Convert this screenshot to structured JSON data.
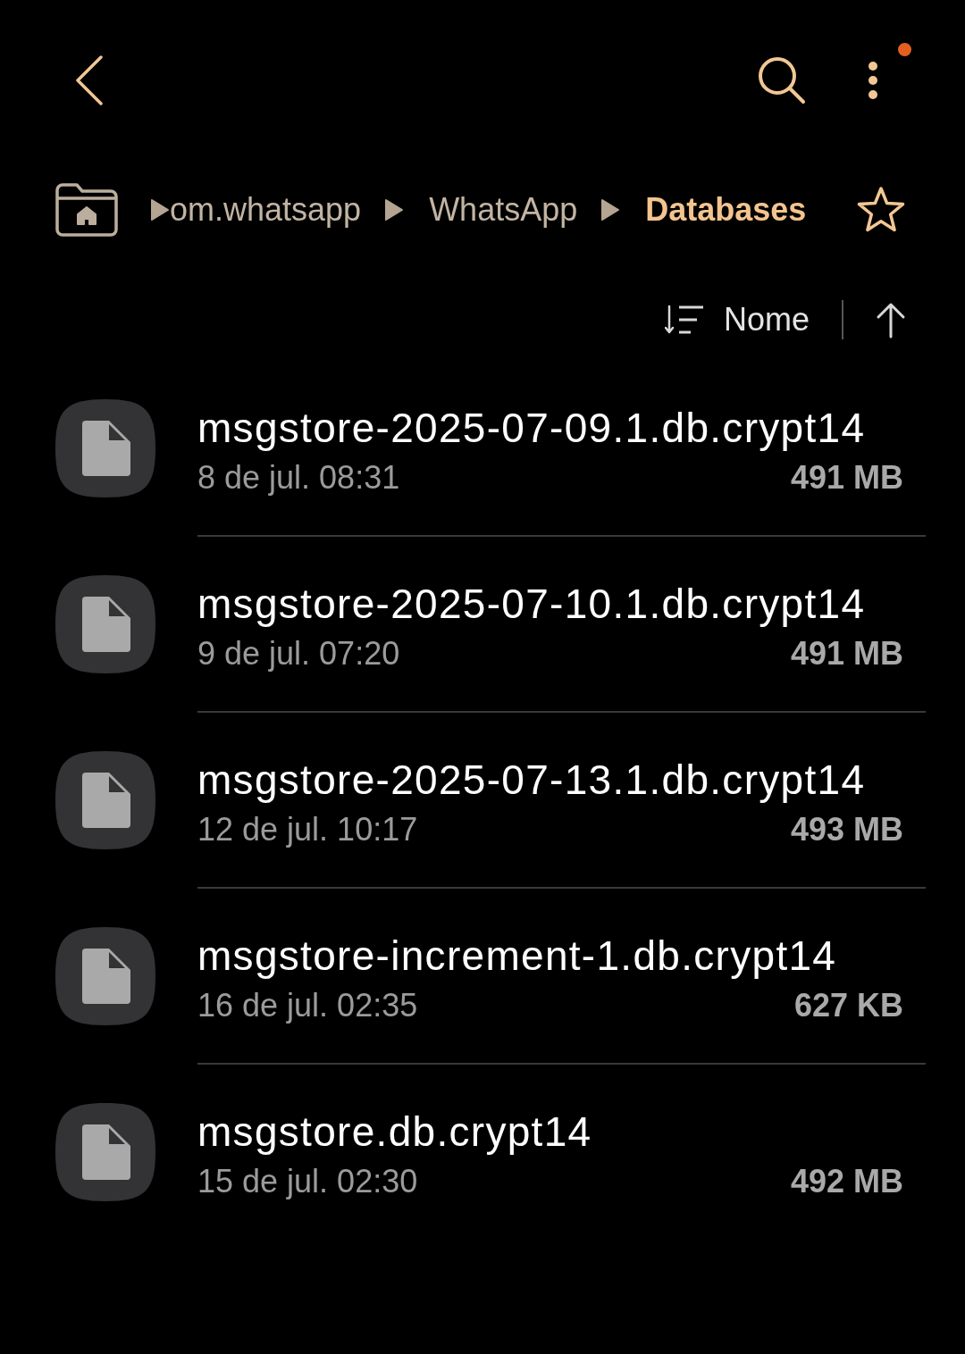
{
  "toolbar": {
    "menu": {
      "badge": true
    }
  },
  "breadcrumbs": [
    {
      "label": "om.whatsapp",
      "selected": false
    },
    {
      "label": "WhatsApp",
      "selected": false
    },
    {
      "label": "Databases",
      "selected": true
    }
  ],
  "favorite": {
    "starred": false
  },
  "sort": {
    "label": "Nome",
    "ascending": true
  },
  "files": [
    {
      "name": "msgstore-2025-07-09.1.db.crypt14",
      "date": "8 de jul. 08:31",
      "size": "491 MB"
    },
    {
      "name": "msgstore-2025-07-10.1.db.crypt14",
      "date": "9 de jul. 07:20",
      "size": "491 MB"
    },
    {
      "name": "msgstore-2025-07-13.1.db.crypt14",
      "date": "12 de jul. 10:17",
      "size": "493 MB"
    },
    {
      "name": "msgstore-increment-1.db.crypt14",
      "date": "16 de jul. 02:35",
      "size": "627 KB"
    },
    {
      "name": "msgstore.db.crypt14",
      "date": "15 de jul. 02:30",
      "size": "492 MB"
    }
  ]
}
